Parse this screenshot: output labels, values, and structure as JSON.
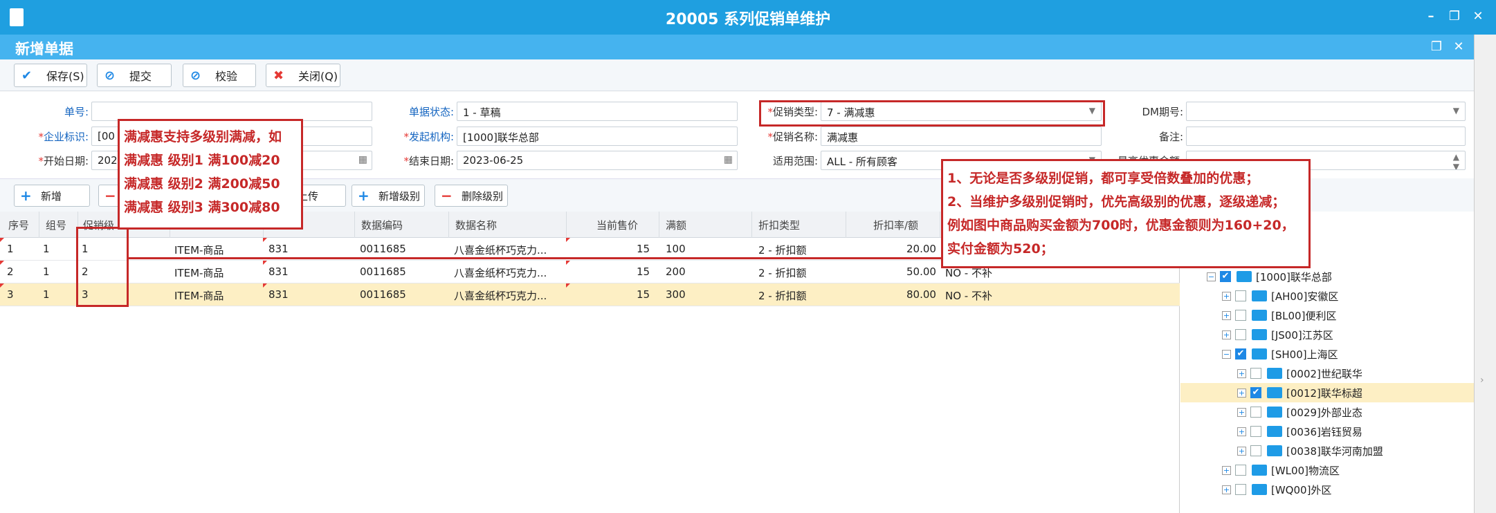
{
  "window": {
    "title": "20005 系列促销单维护",
    "subtitle": "新增单据"
  },
  "toolbar": {
    "save": "保存(S)",
    "submit": "提交",
    "verify": "校验",
    "close": "关闭(Q)"
  },
  "form": {
    "doc_no_label": "单号:",
    "doc_no_value": "",
    "company_label": "企业标识:",
    "company_value": "[00",
    "start_date_label": "开始日期:",
    "start_date_value": "202",
    "status_label": "单据状态:",
    "status_value": "1 - 草稿",
    "org_label": "发起机构:",
    "org_value": "[1000]联华总部",
    "end_date_label": "结束日期:",
    "end_date_value": "2023-06-25",
    "promo_type_label": "促销类型:",
    "promo_type_value": "7 - 满减惠",
    "promo_name_label": "促销名称:",
    "promo_name_value": "满减惠",
    "scope_label": "适用范围:",
    "scope_value": "ALL - 所有顾客",
    "dm_label": "DM期号:",
    "dm_value": "",
    "remark_label": "备注:",
    "remark_value": "",
    "max_label": "最高优惠金额:",
    "max_value": ""
  },
  "gridbar": {
    "add": "新增",
    "upload": "上传",
    "add_level": "新增级别",
    "del_level": "删除级别"
  },
  "grid": {
    "headers": [
      "序号",
      "组号",
      "促销级",
      "数据编码",
      "数据名称",
      "当前售价",
      "满额",
      "折扣类型",
      "折扣率/额"
    ],
    "rows": [
      {
        "seq": "1",
        "group": "1",
        "level": "1",
        "type": "ITEM-商品",
        "code": "831",
        "data_code": "0011685",
        "name": "八喜金纸杯巧克力...",
        "price": "15",
        "full": "100",
        "disc_type": "2 - 折扣额",
        "disc": "20.00",
        "extra": ""
      },
      {
        "seq": "2",
        "group": "1",
        "level": "2",
        "type": "ITEM-商品",
        "code": "831",
        "data_code": "0011685",
        "name": "八喜金纸杯巧克力...",
        "price": "15",
        "full": "200",
        "disc_type": "2 - 折扣额",
        "disc": "50.00",
        "extra": "NO - 不补"
      },
      {
        "seq": "3",
        "group": "1",
        "level": "3",
        "type": "ITEM-商品",
        "code": "831",
        "data_code": "0011685",
        "name": "八喜金纸杯巧克力...",
        "price": "15",
        "full": "300",
        "disc_type": "2 - 折扣额",
        "disc": "80.00",
        "extra": "NO - 不补"
      }
    ]
  },
  "tree": {
    "nodes": [
      {
        "label": "[1000]联华总部"
      },
      {
        "label": "[AH00]安徽区"
      },
      {
        "label": "[BL00]便利区"
      },
      {
        "label": "[JS00]江苏区"
      },
      {
        "label": "[SH00]上海区"
      },
      {
        "label": "[0002]世纪联华"
      },
      {
        "label": "[0012]联华标超"
      },
      {
        "label": "[0029]外部业态"
      },
      {
        "label": "[0036]岩钰贸易"
      },
      {
        "label": "[0038]联华河南加盟"
      },
      {
        "label": "[WL00]物流区"
      },
      {
        "label": "[WQ00]外区"
      }
    ]
  },
  "annotation1": {
    "line1": "满减惠支持多级别满减，如",
    "line2": "满减惠 级别1 满100减20",
    "line3": "满减惠 级别2 满200减50",
    "line4": "满减惠 级别3 满300减80"
  },
  "annotation2": {
    "line1": "1、无论是否多级别促销，都可享受倍数叠加的优惠；",
    "line2": "2、当维护多级别促销时，优先高级别的优惠，逐级递减；",
    "line3": "例如图中商品购买金额为700时，优惠金额则为160+20，",
    "line4": "实付金额为520；"
  },
  "colors": {
    "titlebar": "#1f9fe0",
    "subbar": "#45b3ef",
    "annotation": "#c62828",
    "selected_row": "#fdefc4"
  }
}
